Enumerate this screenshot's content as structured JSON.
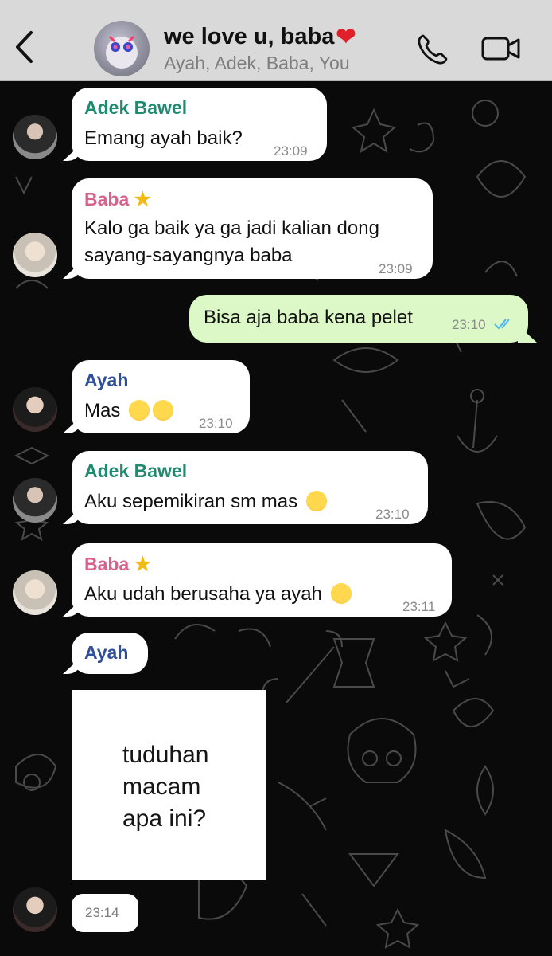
{
  "header": {
    "title": "we love u, baba",
    "subtitle": "Ayah, Adek, Baba, You"
  },
  "messages": [
    {
      "sender": "Adek Bawel",
      "sender_color": "#1f8a70",
      "lines": [
        "Emang ayah baik?"
      ],
      "time": "23:09"
    },
    {
      "sender": "Baba",
      "sender_color": "#d8608a",
      "lines": [
        "Kalo ga baik ya ga jadi kalian dong",
        "sayang-sayangnya baba"
      ],
      "time": "23:09"
    },
    {
      "sender": "You",
      "lines": [
        "Bisa aja baba kena pelet"
      ],
      "time": "23:10",
      "status": "read"
    },
    {
      "sender": "Ayah",
      "sender_color": "#2f4f9a",
      "lines": [
        "Mas"
      ],
      "time": "23:10"
    },
    {
      "sender": "Adek Bawel",
      "sender_color": "#1f8a70",
      "lines": [
        "Aku sepemikiran sm mas"
      ],
      "time": "23:10"
    },
    {
      "sender": "Baba",
      "sender_color": "#d8608a",
      "lines": [
        "Aku udah berusaha ya ayah"
      ],
      "time": "23:11"
    },
    {
      "sender": "Ayah",
      "sender_color": "#2f4f9a",
      "sticker_text": "tuduhan\nmacam\napa ini?",
      "time": "23:14"
    }
  ],
  "colors": {
    "header_bg": "#d9d9d9",
    "incoming_bubble": "#ffffff",
    "outgoing_bubble": "#dcf8c6",
    "read_ticks": "#4fb6ec"
  },
  "icons": {
    "back": "chevron-left-icon",
    "call": "phone-icon",
    "video": "video-camera-icon"
  }
}
